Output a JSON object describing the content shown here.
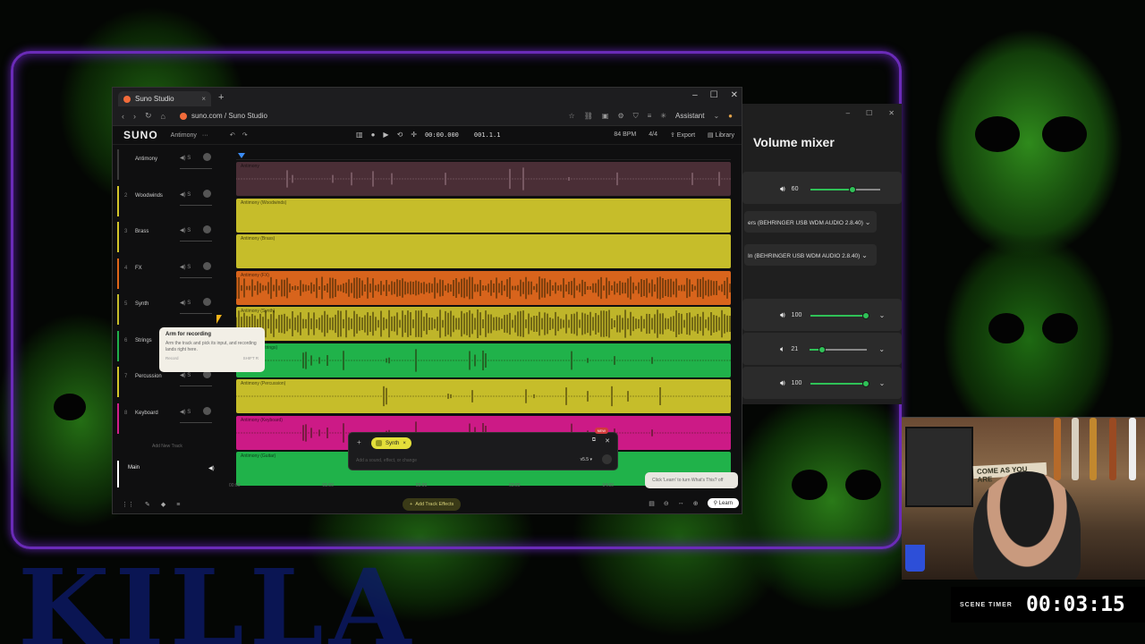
{
  "overlay": {
    "background_text": "KILLA",
    "scene_timer_label": "SCENE TIMER",
    "scene_timer_value": "00:03:15"
  },
  "browser": {
    "tab_title": "Suno Studio",
    "url": "suno.com / Suno Studio",
    "assistant_label": "Assistant"
  },
  "app": {
    "logo": "SUNO",
    "project_name": "Antimony",
    "time_display": "00:00.000",
    "bar_display": "001.1.1",
    "bpm": "84 BPM",
    "time_signature": "4/4",
    "export_label": "Export",
    "library_label": "Library",
    "tracks": [
      {
        "num": "",
        "name": "Antimony",
        "color": "#3a3a3a",
        "lane_label": "Antimony",
        "lane_color": "#4a2e36"
      },
      {
        "num": "2",
        "name": "Woodwinds",
        "color": "#d3c62a",
        "lane_label": "Antimony (Woodwinds)",
        "lane_color": "#c6bd2a"
      },
      {
        "num": "3",
        "name": "Brass",
        "color": "#d3c62a",
        "lane_label": "Antimony (Brass)",
        "lane_color": "#c6bd2a"
      },
      {
        "num": "4",
        "name": "FX",
        "color": "#e06618",
        "lane_label": "Antimony (FX)",
        "lane_color": "#d8641c"
      },
      {
        "num": "5",
        "name": "Synth",
        "color": "#c6bd2a",
        "lane_label": "Antimony (Synth)",
        "lane_color": "#bfb52a"
      },
      {
        "num": "6",
        "name": "Strings",
        "color": "#1fb04a",
        "lane_label": "Antimony (Strings)",
        "lane_color": "#20b24a"
      },
      {
        "num": "7",
        "name": "Percussion",
        "color": "#d3c62a",
        "lane_label": "Antimony (Percussion)",
        "lane_color": "#c6bd2a"
      },
      {
        "num": "8",
        "name": "Keyboard",
        "color": "#d11e8a",
        "lane_label": "Antimony (Keyboard)",
        "lane_color": "#cc1a86"
      },
      {
        "num": "9",
        "name": "",
        "color": "#1fb04a",
        "lane_label": "Antimony (Guitar)",
        "lane_color": "#20b24a"
      }
    ],
    "tooltip": {
      "title": "Arm for recording",
      "body": "Arm the track and pick its input, and recording lands right here.",
      "action": "Record",
      "shortcut": "SHIFT R"
    },
    "add_new_track": "Add New Track",
    "main_label": "Main",
    "timeline_ticks": [
      "00:00",
      "01:00",
      "02:00",
      "03:00",
      "04:00"
    ],
    "prompt": {
      "chip_label": "Synth",
      "placeholder": "Add a sound, effect, or change",
      "version": "v5.5",
      "new_badge": "NEW"
    },
    "learn_tip": "Click 'Learn' to turn What's This? off",
    "add_track_effects": "Add Track Effects",
    "learn_button": "Learn"
  },
  "mixer": {
    "title": "Volume mixer",
    "master_volume": "60",
    "output_device": "ers (BEHRINGER USB WDM AUDIO 2.8.40)",
    "input_device": "In (BEHRINGER USB WDM AUDIO 2.8.40)",
    "apps": [
      {
        "volume": "100"
      },
      {
        "volume": "21"
      },
      {
        "volume": "100"
      }
    ],
    "accent_color": "#2fc157"
  },
  "webcam": {
    "sign_text": "COME AS YOU ARE"
  }
}
